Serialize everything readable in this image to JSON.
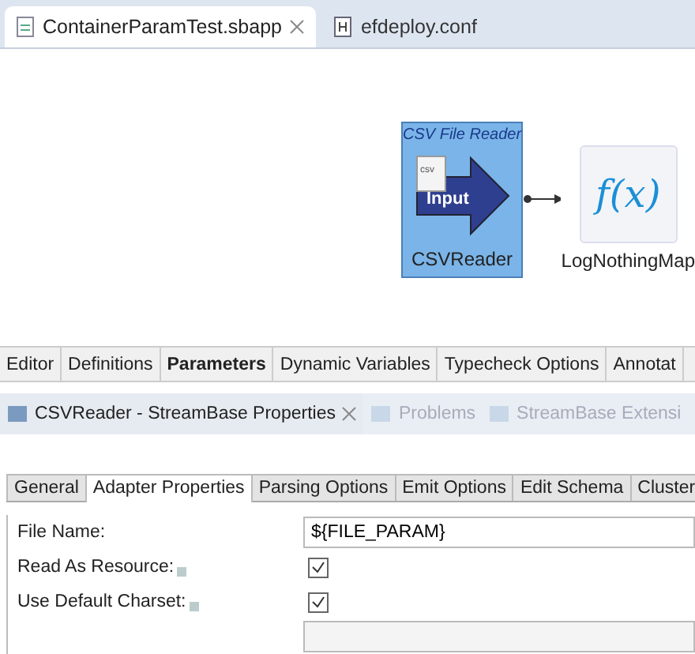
{
  "editor_tabs": [
    {
      "label": "ContainerParamTest.sbapp",
      "selected": true,
      "kind": "app"
    },
    {
      "label": "efdeploy.conf",
      "selected": false,
      "kind": "conf"
    }
  ],
  "canvas": {
    "nodes": [
      {
        "kind": "input",
        "caption": "CSV File Reader",
        "icon_text": "Input",
        "badge": "csv",
        "label": "CSVReader",
        "selected": true
      },
      {
        "kind": "map",
        "icon_text": "f(x)",
        "label": "LogNothingMap",
        "selected": false
      }
    ]
  },
  "editor_pages": [
    {
      "label": "Editor",
      "selected": false
    },
    {
      "label": "Definitions",
      "selected": false
    },
    {
      "label": "Parameters",
      "selected": true
    },
    {
      "label": "Dynamic Variables",
      "selected": false
    },
    {
      "label": "Typecheck Options",
      "selected": false
    },
    {
      "label": "Annotat",
      "selected": false
    }
  ],
  "view_tabs": [
    {
      "label": "CSVReader - StreamBase Properties",
      "selected": true
    },
    {
      "label": "Problems",
      "selected": false
    },
    {
      "label": "StreamBase Extensi",
      "selected": false
    }
  ],
  "property_tabs": [
    {
      "label": "General",
      "selected": false
    },
    {
      "label": "Adapter Properties",
      "selected": true
    },
    {
      "label": "Parsing Options",
      "selected": false
    },
    {
      "label": "Emit Options",
      "selected": false
    },
    {
      "label": "Edit Schema",
      "selected": false
    },
    {
      "label": "Cluster",
      "selected": false
    }
  ],
  "fields": [
    {
      "kind": "text",
      "label": "File Name:",
      "value": "${FILE_PARAM}",
      "info": false
    },
    {
      "kind": "checkbox",
      "label": "Read As Resource:",
      "checked": true,
      "info": true
    },
    {
      "kind": "checkbox",
      "label": "Use Default Charset:",
      "checked": true,
      "info": true
    },
    {
      "kind": "text"
    }
  ]
}
